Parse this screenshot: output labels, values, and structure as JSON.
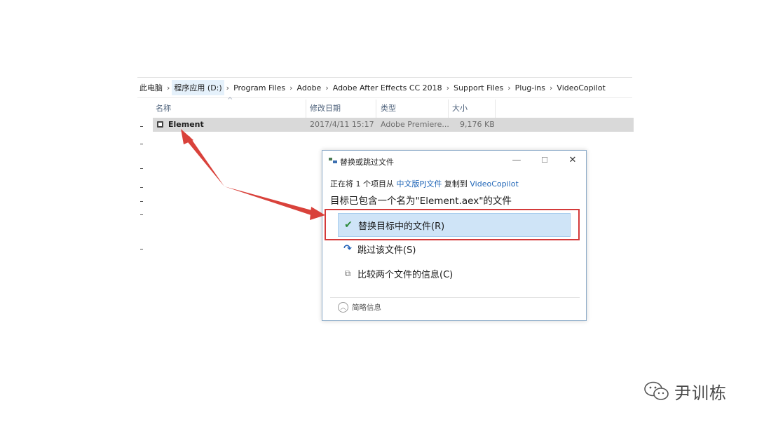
{
  "explorer": {
    "breadcrumb": [
      "此电脑",
      "程序应用 (D:)",
      "Program Files",
      "Adobe",
      "Adobe After Effects CC 2018",
      "Support Files",
      "Plug-ins",
      "VideoCopilot"
    ],
    "columns": {
      "name": "名称",
      "modified": "修改日期",
      "type": "类型",
      "size": "大小"
    },
    "file": {
      "name": "Element",
      "modified": "2017/4/11 15:17",
      "type": "Adobe Premiere...",
      "size": "9,176 KB"
    }
  },
  "dialog": {
    "title": "替换或跳过文件",
    "copy_line": {
      "prefix": "正在将 1 个项目从",
      "source": "中文版PJ文件",
      "middle": "复制到",
      "target": "VideoCopilot"
    },
    "headline": "目标已包含一个名为\"Element.aex\"的文件",
    "options": {
      "replace": "替换目标中的文件(R)",
      "skip": "跳过该文件(S)",
      "compare": "比较两个文件的信息(C)"
    },
    "details": "简略信息",
    "buttons": {
      "minimize": "—",
      "maximize": "☐",
      "close": "✕"
    }
  },
  "icons": {
    "replace": "check-icon",
    "skip": "skip-arrow-icon",
    "compare": "compare-docs-icon",
    "details": "chevron-up-icon"
  },
  "colors": {
    "highlight": "#d43a3a",
    "selection": "#cfe4f7",
    "link": "#1f65b7"
  },
  "watermark": {
    "text": "尹训栋"
  }
}
